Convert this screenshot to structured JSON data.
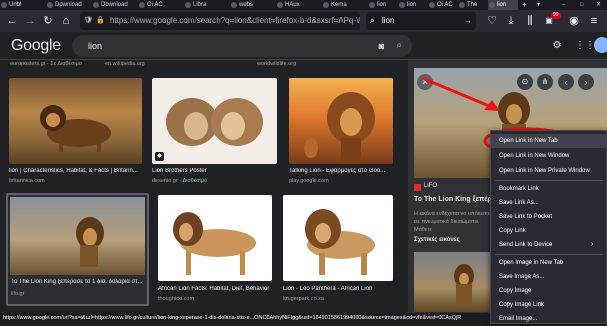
{
  "tabs": [
    {
      "label": "Unbl"
    },
    {
      "label": "Download"
    },
    {
      "label": "Download"
    },
    {
      "label": "Oi AC"
    },
    {
      "label": "Libra"
    },
    {
      "label": "webs"
    },
    {
      "label": "HAux"
    },
    {
      "label": "Kema"
    },
    {
      "label": "lion"
    },
    {
      "label": "lion"
    },
    {
      "label": "Oi AC"
    },
    {
      "label": "The"
    },
    {
      "label": "lion"
    }
  ],
  "nav": {
    "url": "https://www.google.com/search?q=lion&client=firefox-b-d&sxsrf=APq-WBvuZ",
    "search_value": "lion",
    "badge": "99"
  },
  "google": {
    "logo": "Google",
    "query": "lion"
  },
  "sources_top": [
    "europosters.gr · Σε Διαθέσιμο",
    "en.wikipedia.org",
    "worldwildlife.org"
  ],
  "results": [
    {
      "caption": "lion | Characteristics, Habitat, & Facts | Britann...",
      "source": "britannica.com",
      "extra": ""
    },
    {
      "caption": "Lion Brothers Poster",
      "source": "desenio.gr",
      "extra": "Διαθέσιμο"
    },
    {
      "caption": "Talking Lion - Εφαρμογές στο Goo...",
      "source": "play.google.com",
      "extra": ""
    },
    {
      "caption": "To The Lion King ξεπέρασε το 1 δισ. δολάρια στ...",
      "source": "lifo.gr",
      "extra": ""
    },
    {
      "caption": "African Lion Facts: Habitat, Diet, Behavior",
      "source": "thoughtco.com",
      "extra": ""
    },
    {
      "caption": "Lion - Leo Panthera - African Lion",
      "source": "krugerpark.co.za",
      "extra": ""
    }
  ],
  "preview": {
    "source_logo": "LiFO",
    "title": "Το The Lion King ξεπέρ",
    "desc": "Η εικόνα ενδέχεται να υπόκειται σε πνευματικά δικαιώματα. Μάθετε",
    "related": "Σχετικές εικόνες"
  },
  "context_menu": {
    "items": [
      "Open Link in New Tab",
      "Open Link in New Window",
      "Open Link in New Private Window",
      "Bookmark Link",
      "Save Link As...",
      "Save Link to Pocket",
      "Copy Link",
      "Send Link to Device",
      "Open Image in New Tab",
      "Save Image As...",
      "Copy Image",
      "Copy Image Link",
      "Email Image..."
    ]
  },
  "status_bar": "https://www.google.com/url?sa=i&url=https://www.lifo.gr/culture/lion-king-xeperase-1-dis-dolaria-stis-e...ONC0AhhyNiFIgg&ust=1649015861994000&source=images&cd=vfe&ved=0CAsQjR",
  "colors": {
    "annotation": "#e8141a",
    "bg": "#202124"
  }
}
